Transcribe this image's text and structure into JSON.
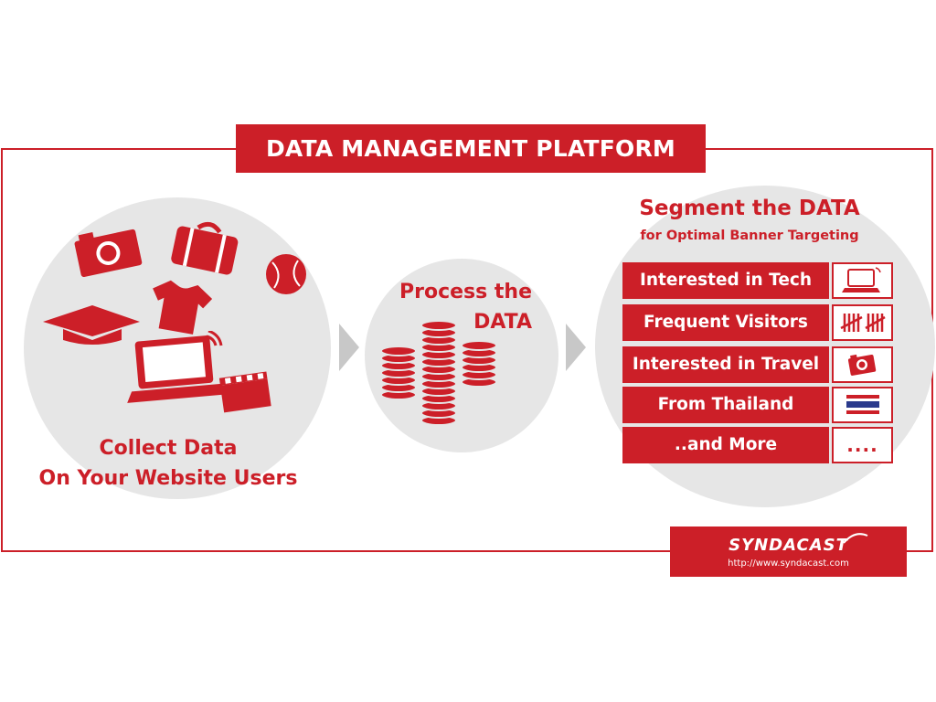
{
  "title": "DATA MANAGEMENT PLATFORM (DMP)",
  "collect": {
    "line1": "Collect Data",
    "line2": "On Your Website Users"
  },
  "process": {
    "line1": "Process the",
    "line2": "DATA"
  },
  "segment": {
    "title": "Segment the DATA",
    "subtitle": "for Optimal Banner Targeting"
  },
  "segments": [
    {
      "label": "Interested in Tech",
      "icon": "laptop-icon"
    },
    {
      "label": "Frequent Visitors",
      "icon": "tally-icon"
    },
    {
      "label": "Interested in Travel",
      "icon": "camera-icon"
    },
    {
      "label": "From Thailand",
      "icon": "thailand-flag-icon"
    },
    {
      "label": "..and More",
      "icon": "more-dots-icon"
    }
  ],
  "more_icon_text": "....",
  "logo": {
    "name": "SYNDACAST",
    "url": "http://www.syndacast.com"
  },
  "colors": {
    "accent": "#cc1f28",
    "circle": "#e6e6e6",
    "arrow": "#c8c8c8"
  }
}
